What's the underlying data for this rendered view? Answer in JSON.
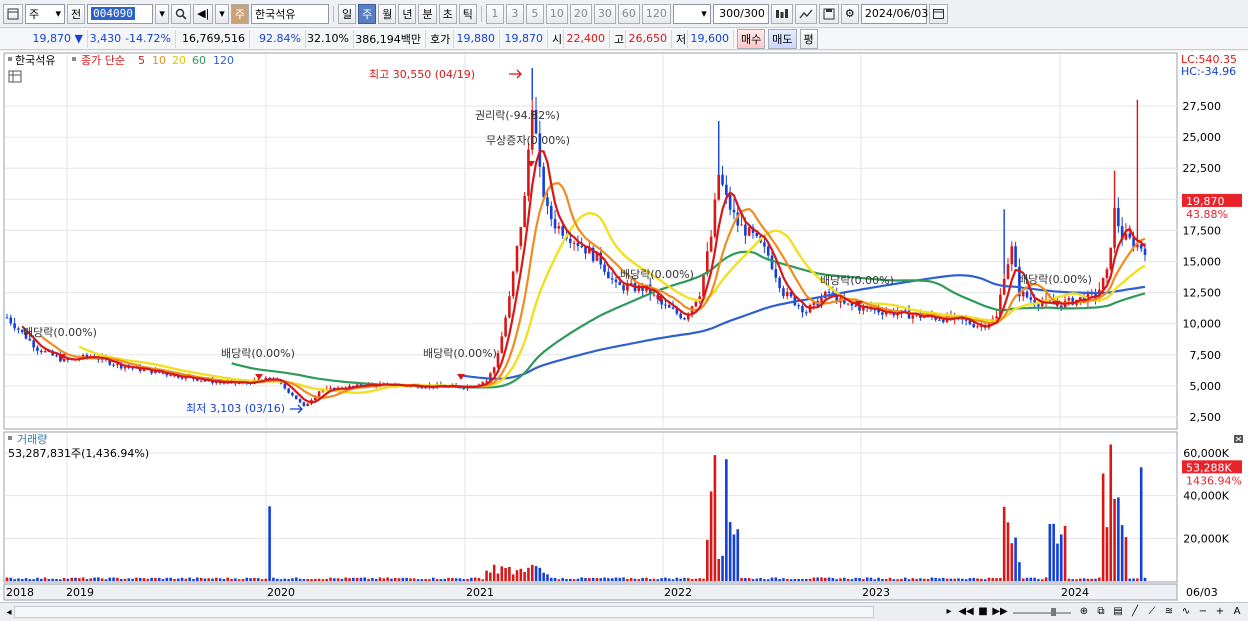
{
  "toolbar": {
    "period_label": "주",
    "prev_label": "전",
    "stock_code": "004090",
    "stock_name_tag": "주",
    "stock_name": "한국석유",
    "period_tabs": [
      "일",
      "주",
      "월",
      "년",
      "분",
      "초",
      "틱"
    ],
    "active_period": "주",
    "interval_buttons": [
      "1",
      "3",
      "5",
      "10",
      "20",
      "30",
      "60",
      "120"
    ],
    "count_value": "300",
    "count_total": "/300",
    "date_value": "2024/06/03"
  },
  "quote_bar": {
    "price": "19,870",
    "direction": "▼",
    "change": "3,430",
    "change_pct": "-14.72%",
    "volume": "16,769,516",
    "pct1": "92.84%",
    "pct2": "32.10%",
    "amount": "386,194백만",
    "ask_label": "호가",
    "ask1": "19,880",
    "ask2": "19,870",
    "open_label": "시",
    "open": "22,400",
    "high_label": "고",
    "high": "26,650",
    "low_label": "저",
    "low": "19,600",
    "buy_label": "매수",
    "sell_label": "매도",
    "eval_label": "평"
  },
  "price_pane": {
    "legend_name": "한국석유",
    "legend_title": "종가 단순",
    "ma_periods": [
      "5",
      "10",
      "20",
      "60",
      "120"
    ],
    "ma_colors": [
      "#d81818",
      "#f08c1e",
      "#f0e020",
      "#2e9a5a",
      "#2f5fd0"
    ],
    "lc_label": "LC:540.35",
    "hc_label": "HC:-34.96",
    "y_ticks": [
      "27,500",
      "25,000",
      "22,500",
      "20,000",
      "17,500",
      "15,000",
      "12,500",
      "10,000",
      "7,500",
      "5,000",
      "2,500"
    ],
    "current_price": "19,870",
    "current_pct": "43.88%",
    "annotations": [
      {
        "text": "최고 30,550 (04/19)"
      },
      {
        "text": "권리락(-94.82%)"
      },
      {
        "text": "무상증자(0.00%)"
      },
      {
        "text": "배당락(0.00%)"
      },
      {
        "text": "배당락(0.00%)"
      },
      {
        "text": "배당락(0.00%)"
      },
      {
        "text": "배당락(0.00%)"
      },
      {
        "text": "배당락(0.00%)"
      },
      {
        "text": "배당락(0.00%)"
      },
      {
        "text": "최저 3,103 (03/16)"
      }
    ]
  },
  "volume_pane": {
    "title": "거래량",
    "value_text": "53,287,831주(1,436.94%)",
    "y_ticks": [
      "60,000K",
      "40,000K",
      "20,000K"
    ],
    "current_volume": "53,288K",
    "current_pct": "1436.94%"
  },
  "x_axis": {
    "labels": [
      "2018",
      "2019",
      "2020",
      "2021",
      "2022",
      "2023",
      "2024"
    ],
    "end_label": "06/03"
  },
  "colors": {
    "up": "#d81818",
    "down": "#1440d8",
    "highlight_bg": "#e8242a"
  }
}
